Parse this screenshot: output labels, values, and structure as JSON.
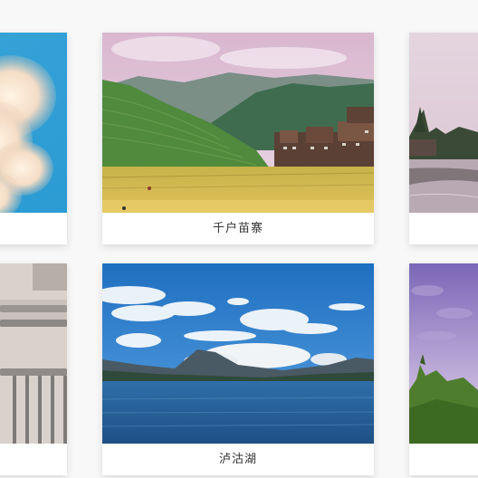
{
  "gallery": {
    "cards": [
      {
        "caption": "",
        "photo_icon": "sky-clouds-image"
      },
      {
        "caption": "千户苗寨",
        "photo_icon": "miao-village-terraces-image"
      },
      {
        "caption": "",
        "photo_icon": "riverside-town-image"
      },
      {
        "caption": "",
        "photo_icon": "balcony-railing-image"
      },
      {
        "caption": "泸沽湖",
        "photo_icon": "lake-mountains-image"
      },
      {
        "caption": "",
        "photo_icon": "purple-sky-trees-image"
      }
    ]
  },
  "colors": {
    "page_background": "#f8f8f8",
    "card_background": "#ffffff",
    "caption_text": "#333333"
  }
}
